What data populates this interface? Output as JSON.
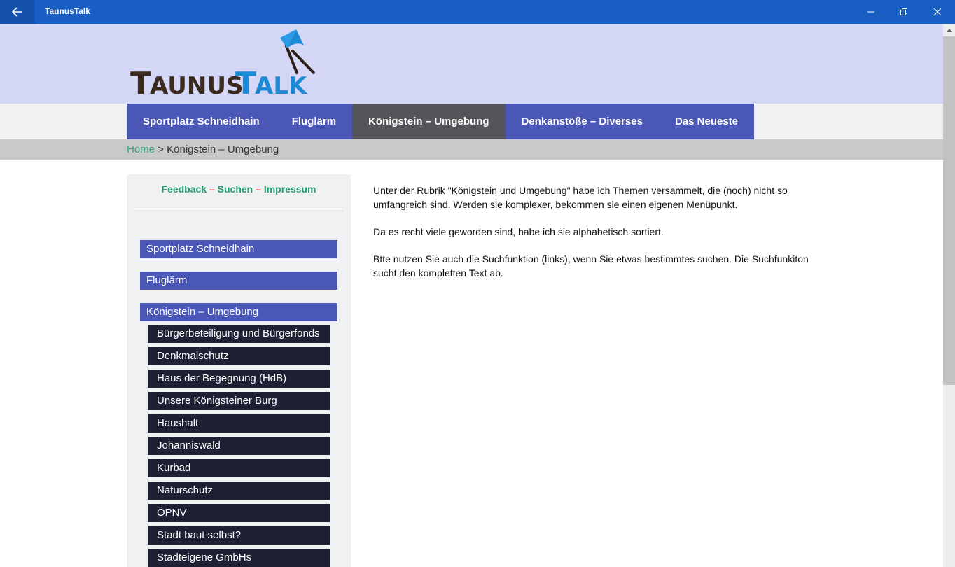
{
  "window": {
    "title": "TaunusTalk"
  },
  "logo": {
    "text": "TAUNUSTALK"
  },
  "nav": {
    "items": [
      {
        "label": "Sportplatz Schneidhain"
      },
      {
        "label": "Fluglärm"
      },
      {
        "label": "Königstein – Umgebung"
      },
      {
        "label": "Denkanstöße – Diverses"
      },
      {
        "label": "Das Neueste"
      }
    ]
  },
  "breadcrumb": {
    "home": "Home",
    "separator": " > ",
    "current": "Königstein – Umgebung"
  },
  "sidebar": {
    "links": {
      "feedback": "Feedback",
      "suchen": "Suchen",
      "impressum": "Impressum",
      "separator": " – "
    },
    "menu": [
      {
        "label": "Sportplatz Schneidhain"
      },
      {
        "label": "Fluglärm"
      },
      {
        "label": "Königstein – Umgebung"
      }
    ],
    "submenu": [
      {
        "label": "Bürgerbeteiligung und Bürgerfonds"
      },
      {
        "label": "Denkmalschutz"
      },
      {
        "label": "Haus der Begegnung (HdB)"
      },
      {
        "label": "Unsere Königsteiner Burg"
      },
      {
        "label": "Haushalt"
      },
      {
        "label": "Johanniswald"
      },
      {
        "label": "Kurbad"
      },
      {
        "label": "Naturschutz"
      },
      {
        "label": "ÖPNV"
      },
      {
        "label": "Stadt baut selbst?"
      },
      {
        "label": "Stadteigene GmbHs"
      }
    ]
  },
  "content": {
    "paragraphs": [
      "Unter der Rubrik \"Königstein und Umgebung\" habe ich Themen versammelt, die (noch) nicht so umfangreich sind. Werden sie komplexer, bekommen sie einen eigenen Menüpunkt.",
      "Da es recht viele geworden sind, habe ich sie alphabetisch sortiert.",
      "Btte nutzen Sie auch die Suchfunktion (links), wenn Sie etwas bestimmtes suchen. Die Suchfunkiton sucht den kompletten Text ab."
    ]
  },
  "colors": {
    "titlebar": "#1a5fc4",
    "nav": "#4a57b7",
    "nav_active": "#545459",
    "submenu": "#1e2133",
    "link_green": "#2a9d6f",
    "link_separator": "#e02020"
  }
}
